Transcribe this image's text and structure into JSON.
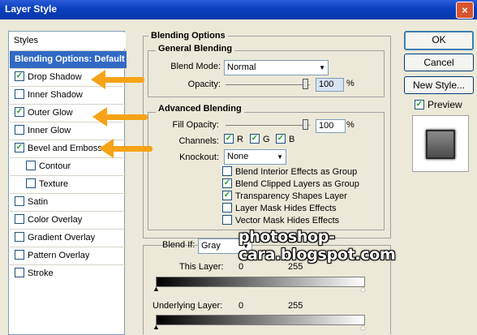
{
  "window": {
    "title": "Layer Style",
    "close_glyph": "×"
  },
  "styles_panel": {
    "header": "Styles",
    "items": [
      {
        "label": "Blending Options: Default",
        "checkbox": false,
        "checked": false,
        "selected": true,
        "indent": false
      },
      {
        "label": "Drop Shadow",
        "checkbox": true,
        "checked": true,
        "selected": false,
        "indent": false
      },
      {
        "label": "Inner Shadow",
        "checkbox": true,
        "checked": false,
        "selected": false,
        "indent": false
      },
      {
        "label": "Outer Glow",
        "checkbox": true,
        "checked": true,
        "selected": false,
        "indent": false
      },
      {
        "label": "Inner Glow",
        "checkbox": true,
        "checked": false,
        "selected": false,
        "indent": false
      },
      {
        "label": "Bevel and Emboss",
        "checkbox": true,
        "checked": true,
        "selected": false,
        "indent": false
      },
      {
        "label": "Contour",
        "checkbox": true,
        "checked": false,
        "selected": false,
        "indent": true
      },
      {
        "label": "Texture",
        "checkbox": true,
        "checked": false,
        "selected": false,
        "indent": true
      },
      {
        "label": "Satin",
        "checkbox": true,
        "checked": false,
        "selected": false,
        "indent": false
      },
      {
        "label": "Color Overlay",
        "checkbox": true,
        "checked": false,
        "selected": false,
        "indent": false
      },
      {
        "label": "Gradient Overlay",
        "checkbox": true,
        "checked": false,
        "selected": false,
        "indent": false
      },
      {
        "label": "Pattern Overlay",
        "checkbox": true,
        "checked": false,
        "selected": false,
        "indent": false
      },
      {
        "label": "Stroke",
        "checkbox": true,
        "checked": false,
        "selected": false,
        "indent": false
      }
    ]
  },
  "blending_options": {
    "title": "Blending Options",
    "general": {
      "title": "General Blending",
      "blend_mode_label": "Blend Mode:",
      "blend_mode_value": "Normal",
      "opacity_label": "Opacity:",
      "opacity_value": "100",
      "opacity_unit": "%"
    },
    "advanced": {
      "title": "Advanced Blending",
      "fill_opacity_label": "Fill Opacity:",
      "fill_opacity_value": "100",
      "fill_opacity_unit": "%",
      "channels_label": "Channels:",
      "channels": [
        {
          "label": "R",
          "checked": true
        },
        {
          "label": "G",
          "checked": true
        },
        {
          "label": "B",
          "checked": true
        }
      ],
      "knockout_label": "Knockout:",
      "knockout_value": "None",
      "options": [
        {
          "label": "Blend Interior Effects as Group",
          "checked": false
        },
        {
          "label": "Blend Clipped Layers as Group",
          "checked": true
        },
        {
          "label": "Transparency Shapes Layer",
          "checked": true
        },
        {
          "label": "Layer Mask Hides Effects",
          "checked": false
        },
        {
          "label": "Vector Mask Hides Effects",
          "checked": false
        }
      ]
    },
    "blend_if": {
      "label": "Blend If:",
      "value": "Gray",
      "this_layer_label": "This Layer:",
      "this_layer_low": "0",
      "this_layer_high": "255",
      "underlying_label": "Underlying Layer:",
      "underlying_low": "0",
      "underlying_high": "255"
    }
  },
  "buttons": {
    "ok": "OK",
    "cancel": "Cancel",
    "new_style": "New Style...",
    "preview_label": "Preview",
    "preview_checked": true
  },
  "watermark": "photoshop-cara.blogspot.com",
  "colors": {
    "selection": "#316ac5",
    "annotation_arrow": "#f6a317",
    "titlebar": "#0a3fc0"
  },
  "check_glyph": "✓"
}
